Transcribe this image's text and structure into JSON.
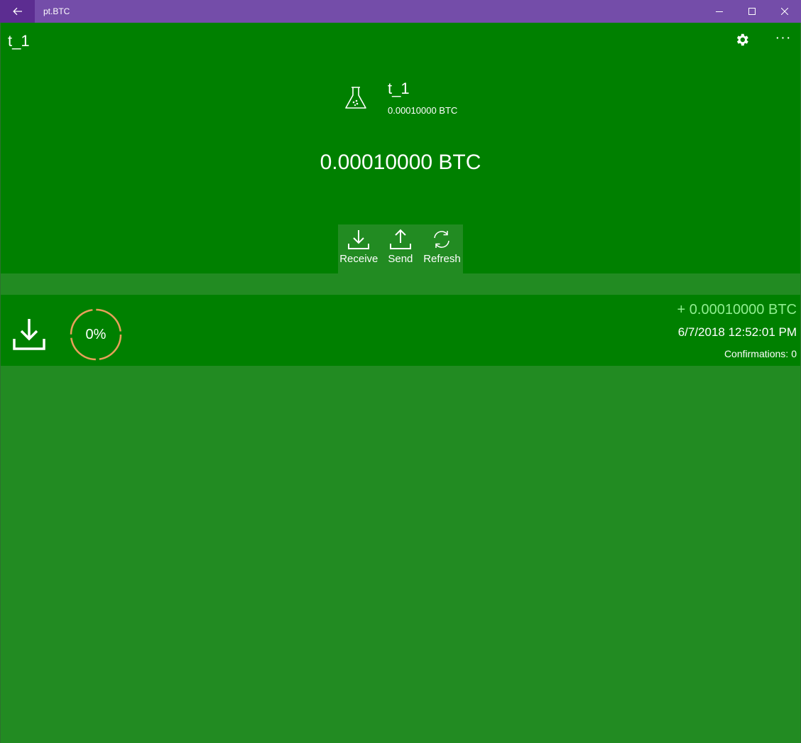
{
  "window": {
    "title": "pt.BTC",
    "back_icon": "arrow-left-icon",
    "controls": [
      "minimize-icon",
      "maximize-icon",
      "close-icon"
    ],
    "accent": "#744da9"
  },
  "header": {
    "page_title": "t_1",
    "settings_icon": "gear-icon",
    "more_label": "···",
    "background": "#008000"
  },
  "wallet": {
    "icon": "flask-icon",
    "name": "t_1",
    "balance_small": "0.00010000 BTC",
    "balance_large": "0.00010000 BTC"
  },
  "actions": [
    {
      "label": "Receive",
      "icon": "download-icon"
    },
    {
      "label": "Send",
      "icon": "upload-icon"
    },
    {
      "label": "Refresh",
      "icon": "refresh-icon"
    }
  ],
  "transactions": [
    {
      "icon": "download-icon",
      "progress_text": "0%",
      "progress_value": 0,
      "amount": "+ 0.00010000 BTC",
      "amount_color": "#90ee90",
      "date": "6/7/2018 12:52:01 PM",
      "confirmations_label": "Confirmations:",
      "confirmations_value": "0"
    }
  ],
  "colors": {
    "primary": "#008000",
    "secondary": "#228b22",
    "progress_ring": "#e8a05a"
  }
}
